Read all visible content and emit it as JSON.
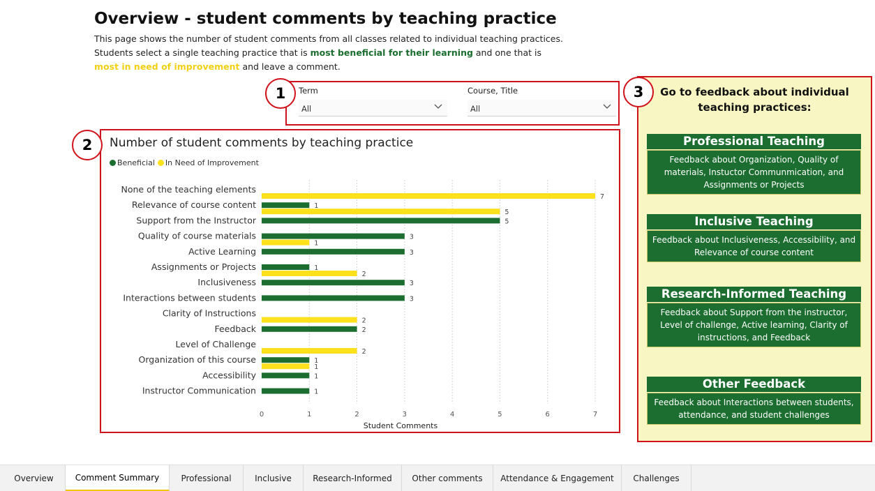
{
  "header": {
    "title": "Overview - student comments by teaching practice",
    "line1": "This page shows the number of student comments from all classes related to individual teaching practices.",
    "line2_pre": "Students select a single teaching practice that is ",
    "line2_green": "most beneficial for their learning",
    "line2_post": " and one that is",
    "line3_yellow": "most in need of improvement",
    "line3_post": " and leave a comment."
  },
  "callouts": [
    "1",
    "2",
    "3"
  ],
  "filters": {
    "term_label": "Term",
    "term_value": "All",
    "course_label": "Course, Title",
    "course_value": "All"
  },
  "colors": {
    "beneficial": "#1b6e2f",
    "improvement": "#fde11d",
    "accent_red": "#d0121b",
    "panel_bg": "#f8f6c2"
  },
  "chart_data": {
    "type": "bar",
    "orientation": "horizontal",
    "title": "Number of student comments by teaching practice",
    "xlabel": "Student Comments",
    "xlim": [
      0,
      7
    ],
    "xticks": [
      0,
      1,
      2,
      3,
      4,
      5,
      6,
      7
    ],
    "grid": true,
    "legend_placement": "top-left",
    "categories": [
      "None of the teaching elements",
      "Relevance of course content",
      "Support from the Instructor",
      "Quality of course materials",
      "Active Learning",
      "Assignments or Projects",
      "Inclusiveness",
      "Interactions between students",
      "Clarity of Instructions",
      "Feedback",
      "Level of Challenge",
      "Organization of this course",
      "Accessibility",
      "Instructor Communication"
    ],
    "series": [
      {
        "name": "Beneficial",
        "values": [
          null,
          1,
          5,
          3,
          3,
          1,
          3,
          3,
          null,
          2,
          null,
          1,
          1,
          1
        ]
      },
      {
        "name": "In Need of Improvement",
        "values": [
          7,
          5,
          null,
          1,
          null,
          2,
          null,
          null,
          2,
          null,
          2,
          1,
          null,
          null
        ]
      }
    ]
  },
  "right_panel": {
    "heading_line1": "Go to feedback about individual",
    "heading_line2": "teaching practices:",
    "cards": [
      {
        "title": "Professional Teaching",
        "body": "Feedback about Organization, Quality of materials, Instuctor Communmication, and Assignments or Projects"
      },
      {
        "title": "Inclusive Teaching",
        "body": "Feedback about Inclusiveness, Accessibility, and Relevance of course content"
      },
      {
        "title": "Research-Informed Teaching",
        "body": "Feedback about Support from the instructor, Level of challenge, Active learning, Clarity of instructions, and Feedback"
      },
      {
        "title": "Other Feedback",
        "body": "Feedback about Interactions between students, attendance, and student challenges"
      }
    ]
  },
  "tabs": [
    {
      "label": "Overview",
      "active": false
    },
    {
      "label": "Comment Summary",
      "active": true
    },
    {
      "label": "Professional",
      "active": false
    },
    {
      "label": "Inclusive",
      "active": false
    },
    {
      "label": "Research-Informed",
      "active": false
    },
    {
      "label": "Other comments",
      "active": false
    },
    {
      "label": "Attendance & Engagement",
      "active": false
    },
    {
      "label": "Challenges",
      "active": false
    }
  ]
}
